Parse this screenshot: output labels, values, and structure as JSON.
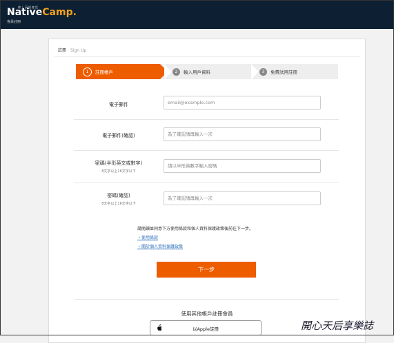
{
  "header": {
    "brand_top": "線上英語會話",
    "brand_main": "Native",
    "brand_accent": "Camp.",
    "brand_sub": "會員註冊"
  },
  "breadcrumb": {
    "zh": "註冊",
    "en": "Sign Up"
  },
  "steps": [
    {
      "num": "1",
      "label": "註冊帳戶",
      "active": true
    },
    {
      "num": "2",
      "label": "輸入用戶資料",
      "active": false
    },
    {
      "num": "3",
      "label": "免費試用註冊",
      "active": false
    }
  ],
  "form": {
    "email": {
      "label": "電子郵件",
      "placeholder": "email@example.com"
    },
    "email_confirm": {
      "label": "電子郵件(確認)",
      "placeholder": "為了確認請再輸入一次"
    },
    "password": {
      "label": "密碼(半形英文或數字)",
      "sub": "8文字以上16文字以下",
      "placeholder": "請以半形英數字輸入密碼"
    },
    "password_confirm": {
      "label": "密碼(確認)",
      "sub": "8文字以上16文字以下",
      "placeholder": "為了確認請再輸入一次"
    }
  },
  "terms": {
    "text": "請閱讀並同意下方使用條款和個人資料保護政策後前往下一步。",
    "link1": "・使用條款",
    "link2": "・關於個人資料保護政策"
  },
  "next_label": "下一步",
  "other_signup": "使用其他帳戶註冊會員",
  "apple_label": "以Apple註冊",
  "watermark": "開心天后享樂誌",
  "colors": {
    "accent": "#ee5c00",
    "header_bg": "#0c1f33",
    "brand_accent": "#f4a21d"
  }
}
